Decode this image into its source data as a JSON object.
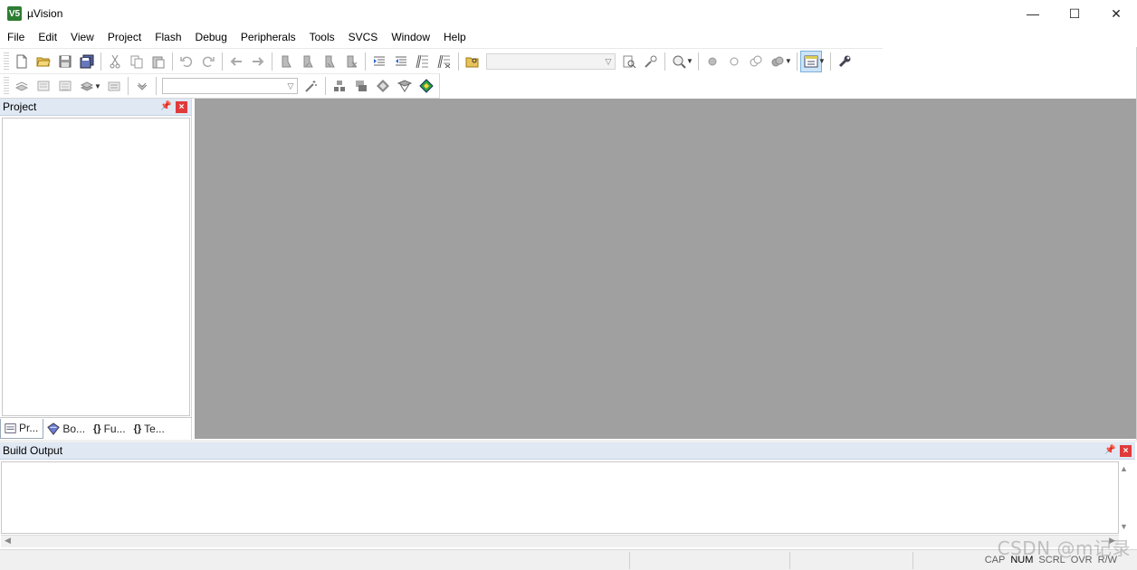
{
  "window": {
    "title": "µVision",
    "app_icon_text": "V5"
  },
  "window_controls": {
    "minimize": "—",
    "maximize": "☐",
    "close": "✕"
  },
  "menu": [
    "File",
    "Edit",
    "View",
    "Project",
    "Flash",
    "Debug",
    "Peripherals",
    "Tools",
    "SVCS",
    "Window",
    "Help"
  ],
  "project_pane": {
    "title": "Project",
    "tabs": [
      {
        "label": "Pr...",
        "icon": "project-tab-icon"
      },
      {
        "label": "Bo...",
        "icon": "books-tab-icon"
      },
      {
        "label": "Fu...",
        "icon": "functions-tab-icon",
        "glyph": "{}"
      },
      {
        "label": "Te...",
        "icon": "templates-tab-icon",
        "glyph": "{}"
      }
    ]
  },
  "build_output": {
    "title": "Build Output"
  },
  "status_bar": {
    "indicators": [
      "CAP",
      "NUM",
      "SCRL",
      "OVR",
      "R/W"
    ],
    "indicator_state": {
      "CAP": "off",
      "NUM": "on",
      "SCRL": "off",
      "OVR": "off",
      "R/W": "off"
    }
  },
  "watermark": "CSDN @m记录",
  "colors": {
    "editor_bg": "#a0a0a0",
    "pane_header": "#dfe8f3",
    "close_red": "#e03a3a"
  }
}
